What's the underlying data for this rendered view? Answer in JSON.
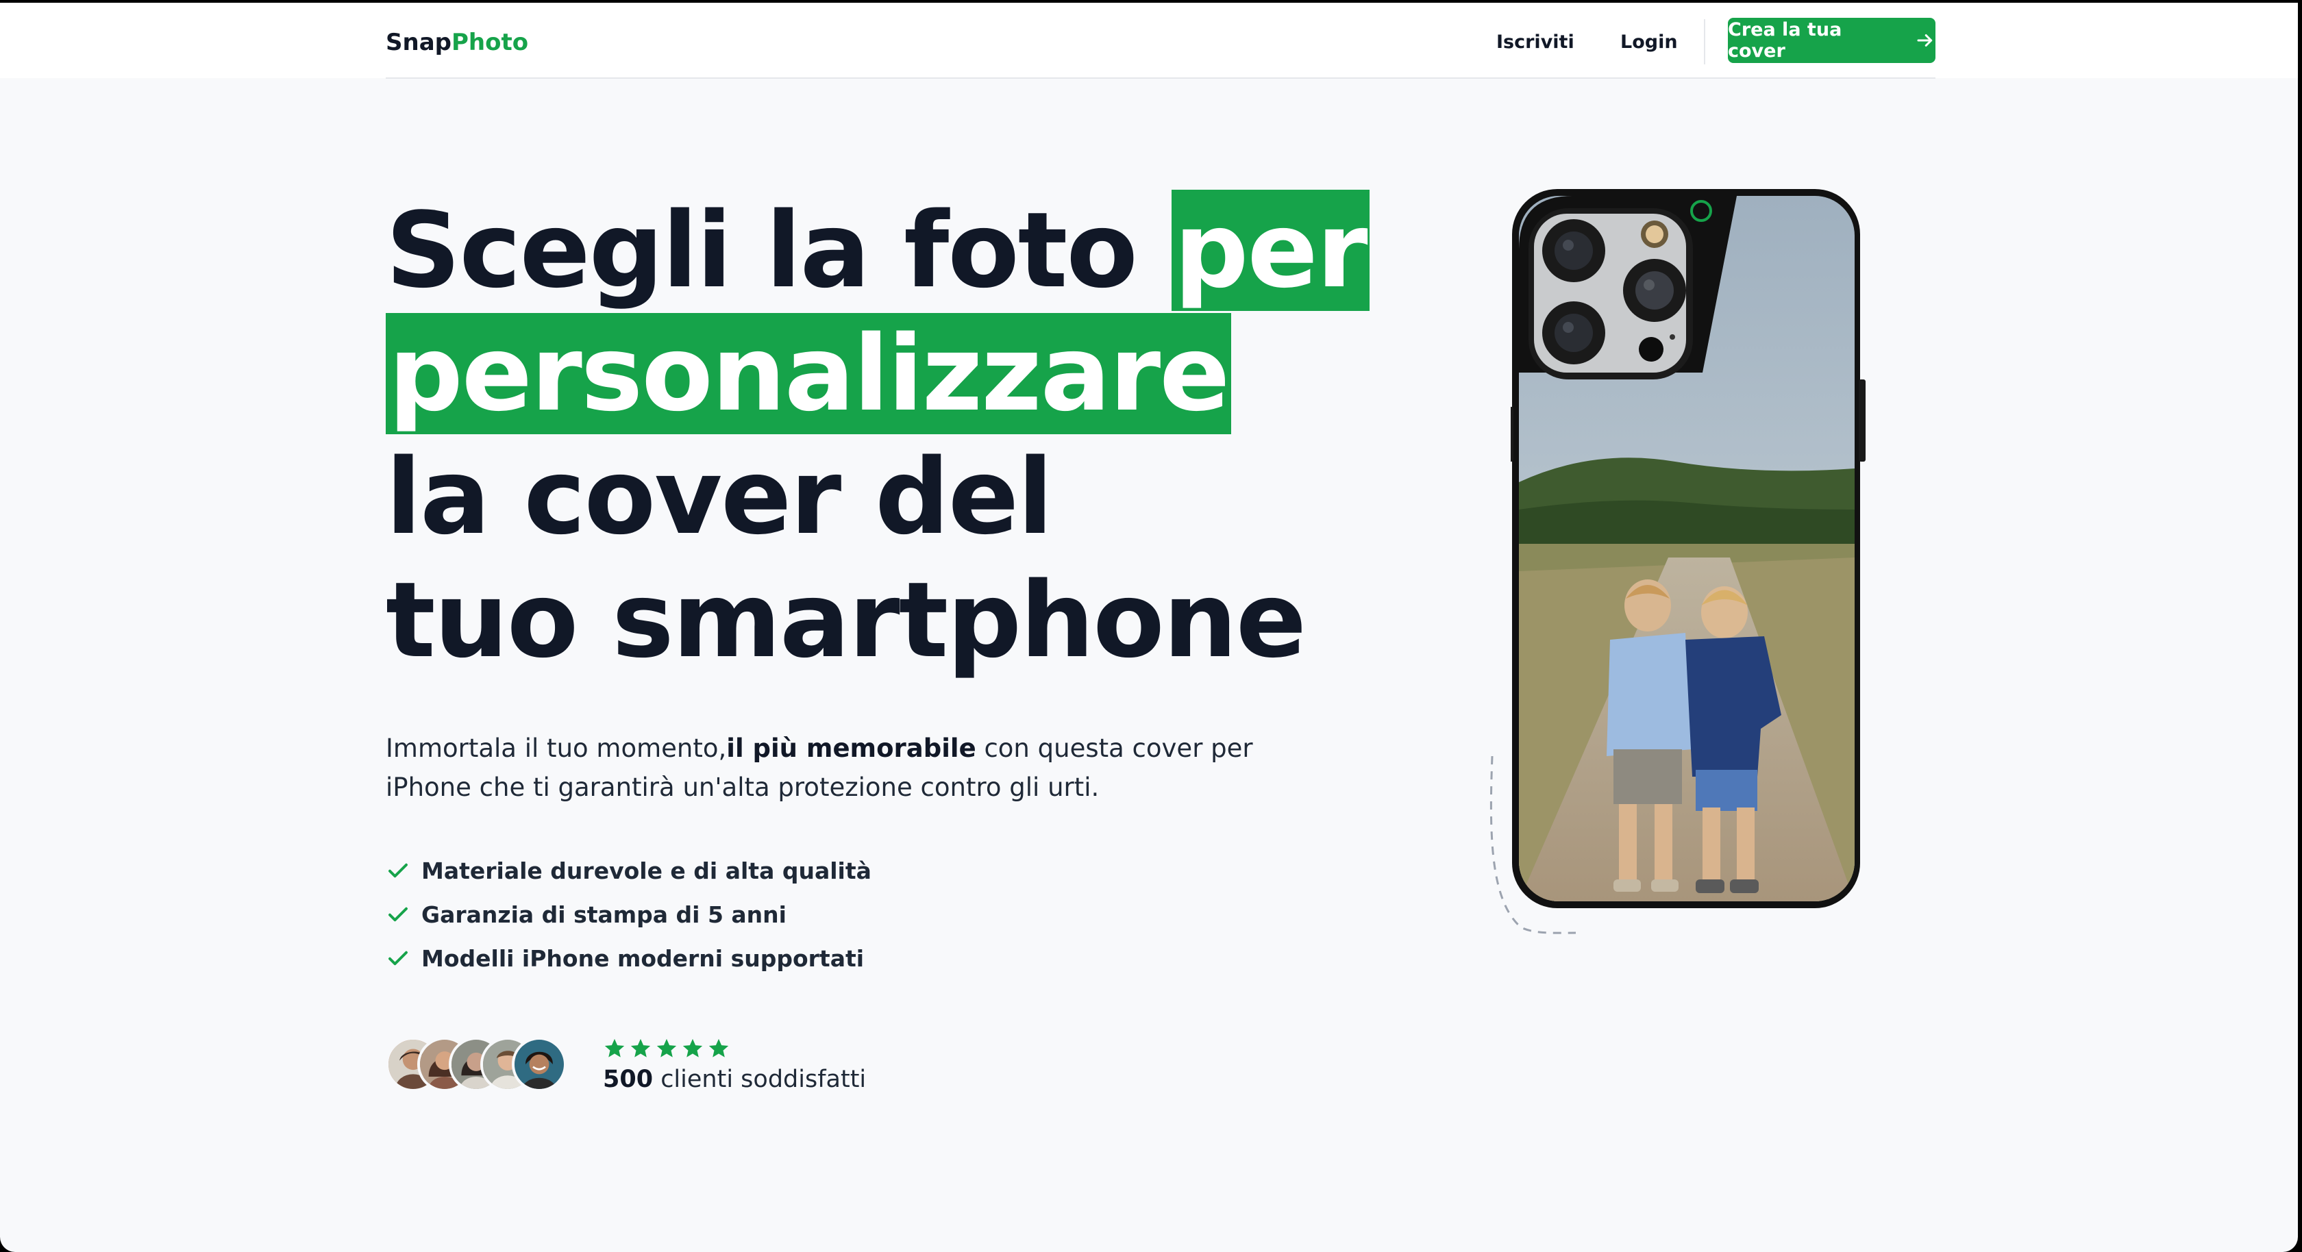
{
  "brand": {
    "part1": "Snap",
    "part2": "Photo"
  },
  "nav": {
    "signup": "Iscriviti",
    "login": "Login",
    "cta": "Crea la tua cover"
  },
  "hero": {
    "line1_text": "Scegli la foto ",
    "line1_highlight": "per",
    "line2_highlight": "personalizzare",
    "line3": "la cover del",
    "line4": "tuo smartphone"
  },
  "description": {
    "part1": "Immortala il tuo momento,",
    "bold": "il più memorabile",
    "part2": " con questa cover per iPhone che ti garantirà un'alta protezione contro gli urti."
  },
  "features": [
    "Materiale durevole e di alta qualità",
    "Garanzia di stampa di 5 anni",
    "Modelli iPhone moderni supportati"
  ],
  "social_proof": {
    "rating_stars": 5,
    "count": "500",
    "label": " clienti soddisfatti"
  },
  "colors": {
    "accent": "#16a34a",
    "text": "#111827",
    "background": "#f8f9fb"
  }
}
